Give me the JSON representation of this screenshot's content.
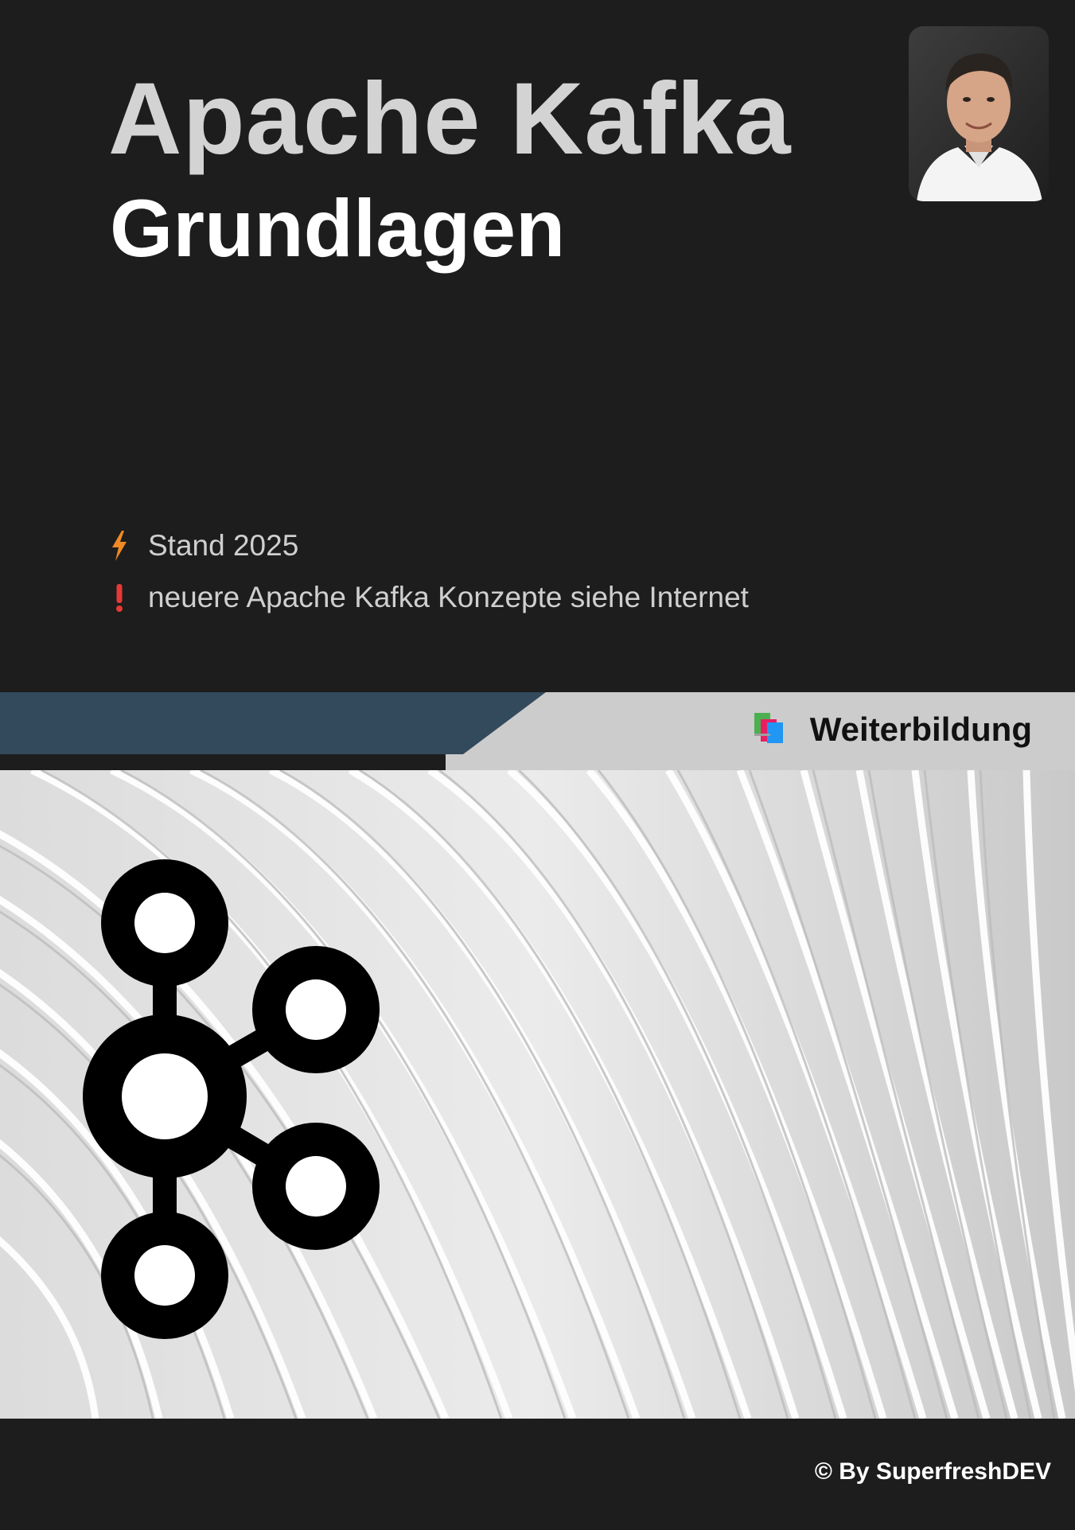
{
  "cover": {
    "title": "Apache Kafka",
    "subtitle": "Grundlagen",
    "notes": [
      {
        "icon": "lightning-icon",
        "text": "Stand 2025"
      },
      {
        "icon": "exclamation-icon",
        "text": "neuere Apache Kafka Konzepte siehe Internet"
      }
    ],
    "category": {
      "icon": "books-icon",
      "label": "Weiterbildung"
    },
    "footer": "© By SuperfreshDEV"
  },
  "colors": {
    "background": "#1d1d1d",
    "title": "#d3d3d3",
    "subtitle": "#ffffff",
    "band_dark": "#33495c",
    "band_light": "#cccccc",
    "lightning": "#f08a24",
    "exclamation": "#e53935"
  }
}
